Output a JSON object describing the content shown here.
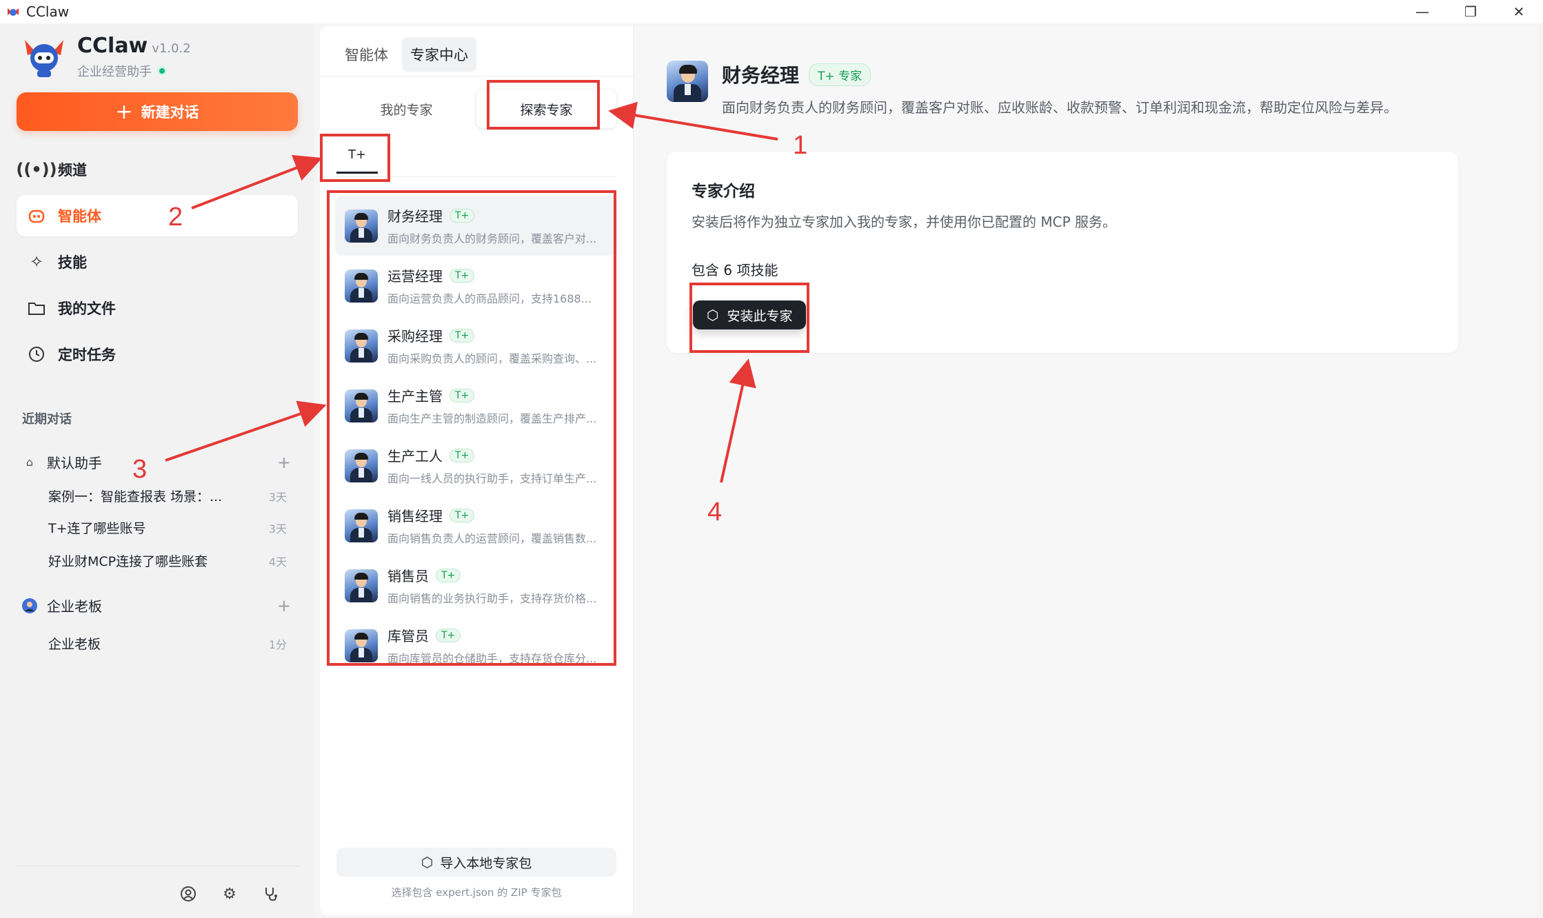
{
  "window": {
    "title": "CClaw",
    "controls": [
      "minimize",
      "restore",
      "close"
    ]
  },
  "brand": {
    "name": "CClaw",
    "version": "v1.0.2",
    "subtitle": "企业经营助手"
  },
  "sidebar": {
    "new_chat_label": "新建对话",
    "nav": [
      {
        "label": "频道",
        "icon": "broadcast-icon",
        "active": false
      },
      {
        "label": "智能体",
        "icon": "robot-icon",
        "active": true
      },
      {
        "label": "技能",
        "icon": "sparkle-icon",
        "active": false
      },
      {
        "label": "我的文件",
        "icon": "folder-icon",
        "active": false
      },
      {
        "label": "定时任务",
        "icon": "clock-icon",
        "active": false
      }
    ],
    "recent_label": "近期对话",
    "groups": [
      {
        "name": "默认助手",
        "chats": [
          {
            "title": "案例一：智能查报表 场景：...",
            "time": "3天"
          },
          {
            "title": "T+连了哪些账号",
            "time": "3天"
          },
          {
            "title": "好业财MCP连接了哪些账套",
            "time": "4天"
          }
        ]
      },
      {
        "name": "企业老板",
        "chats": [
          {
            "title": "企业老板",
            "time": "1分"
          }
        ]
      }
    ],
    "footer_icons": [
      "user-icon",
      "settings-icon",
      "stethoscope-icon"
    ]
  },
  "middle": {
    "tabs": [
      {
        "label": "智能体",
        "active": false
      },
      {
        "label": "专家中心",
        "active": true
      }
    ],
    "segments": [
      {
        "label": "我的专家",
        "active": false
      },
      {
        "label": "探索专家",
        "active": true
      }
    ],
    "filter_tab": "T+",
    "experts": [
      {
        "name": "财务经理",
        "tag": "T+",
        "desc": "面向财务负责人的财务顾问，覆盖客户对...",
        "active": true
      },
      {
        "name": "运营经理",
        "tag": "T+",
        "desc": "面向运营负责人的商品顾问，支持1688...",
        "active": false
      },
      {
        "name": "采购经理",
        "tag": "T+",
        "desc": "面向采购负责人的顾问，覆盖采购查询、...",
        "active": false
      },
      {
        "name": "生产主管",
        "tag": "T+",
        "desc": "面向生产主管的制造顾问，覆盖生产排产...",
        "active": false
      },
      {
        "name": "生产工人",
        "tag": "T+",
        "desc": "面向一线人员的执行助手，支持订单生产...",
        "active": false
      },
      {
        "name": "销售经理",
        "tag": "T+",
        "desc": "面向销售负责人的运营顾问，覆盖销售数...",
        "active": false
      },
      {
        "name": "销售员",
        "tag": "T+",
        "desc": "面向销售的业务执行助手，支持存货价格...",
        "active": false
      },
      {
        "name": "库管员",
        "tag": "T+",
        "desc": "面向库管员的仓储助手，支持存货仓库分...",
        "active": false
      }
    ],
    "import_label": "导入本地专家包",
    "import_hint": "选择包含 expert.json 的 ZIP 专家包"
  },
  "detail": {
    "title": "财务经理",
    "badge": "T+ 专家",
    "description": "面向财务负责人的财务顾问，覆盖客户对账、应收账龄、收款预警、订单利润和现金流，帮助定位风险与差异。",
    "intro_title": "专家介绍",
    "intro_text": "安装后将作为独立专家加入我的专家，并使用你已配置的 MCP 服务。",
    "skills_count": "包含 6 项技能",
    "install_label": "安装此专家"
  },
  "annotations": [
    "1",
    "2",
    "3",
    "4"
  ],
  "colors": {
    "accent": "#ff5a1f",
    "annotation": "#e53935",
    "tag_green": "#12a150",
    "dark_button": "#1f2329"
  }
}
